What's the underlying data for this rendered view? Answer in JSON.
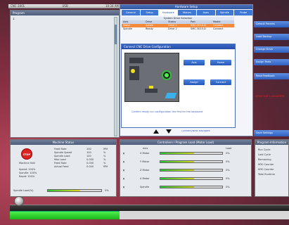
{
  "topbar": {
    "left": "CNC-3001",
    "center": "USB",
    "right": "10:34 AM"
  },
  "program_list": {
    "title": "Program",
    "first_item": "1"
  },
  "main_window": {
    "title": "Hardware Setup",
    "tabs": [
      "General",
      "Setup",
      "Hardware",
      "Motors",
      "Axes",
      "Spindle",
      "Probe"
    ],
    "table_caption": "System Drive Selection",
    "table_headers": [
      "Axis",
      "Drive",
      "Status",
      "Part",
      "Model"
    ],
    "rows": [
      [
        "Motor",
        "Active",
        "Drive 1",
        "SMC-3010-D",
        "Connect"
      ],
      [
        "Spindle",
        "Ready",
        "Drive 2",
        "SMC-3010-D",
        "Connect"
      ]
    ]
  },
  "side_buttons": [
    "Default Params",
    "Load Backup",
    "Change Drive",
    "Assign Ports",
    "Read Feedback",
    "Save Settings"
  ],
  "warning_text": "Drive not Connected",
  "hw_dialog": {
    "title": "Connect CNC Drive Configuration",
    "btn_left_top": "Axis",
    "btn_right_top": "Home",
    "btn_left_bottom": "Assign",
    "btn_right_bottom": "Connect",
    "note": "Confirm ready cnc configuration the first for the keyboard"
  },
  "arrow_label": "Connect/Next Navigate",
  "machine_status": {
    "title": "Machine Status",
    "stop_label": "STOP",
    "stop_caption": "Machine Halt",
    "rows_left": [
      "Speed: 100%",
      "Spindle: 100%",
      "Rapid: 100%"
    ],
    "rows_right_keys": [
      "Feed Rate",
      "Spindle Speed",
      "Spindle Load",
      "Max Load",
      "Feed Rate",
      "Actual Feed"
    ],
    "rows_right_vals": [
      "100",
      "100",
      "100",
      "0.000",
      "0.000",
      "0.000"
    ],
    "rows_right_units": [
      "IPM",
      "%",
      "%",
      "%",
      "%",
      "IPM"
    ],
    "override_label": "Spindle Load(%)",
    "override_value": "0%",
    "override_fraction": 0.6
  },
  "controllers": {
    "title": "Controllers / Program Load (Motor Load)",
    "col_header_left": "Axis",
    "col_header_right": "Load",
    "channels": [
      {
        "label": "X Motor",
        "value": "0%",
        "fraction": 0.55
      },
      {
        "label": "Y Motor",
        "value": "0%",
        "fraction": 0.55
      },
      {
        "label": "Z Motor",
        "value": "0%",
        "fraction": 0.55
      },
      {
        "label": "A Motor",
        "value": "0%",
        "fraction": 0.55
      },
      {
        "label": "Spindle",
        "value": "0%",
        "fraction": 0.55
      }
    ]
  },
  "program_info": {
    "title": "Program Information",
    "rows": [
      "Run Cycle",
      "Last Cycle",
      "Remaining",
      "M30 Counter",
      "M30 Counter",
      "Total Runtime"
    ]
  },
  "colors": {
    "accent": "#3f78d4",
    "warning": "#d22222",
    "progress": "#2fc03a"
  }
}
